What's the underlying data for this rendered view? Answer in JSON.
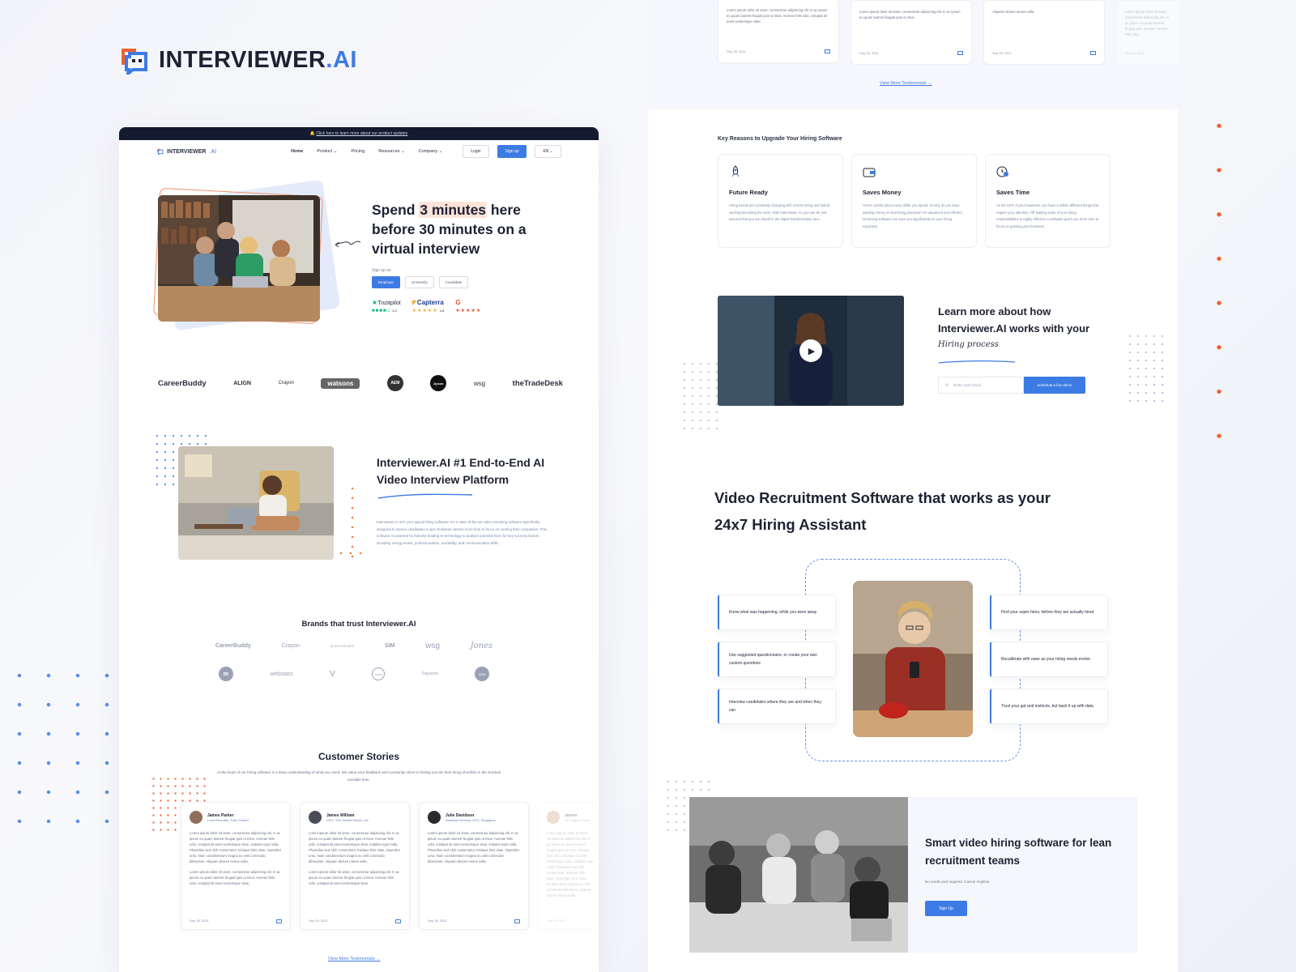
{
  "brand": {
    "name_main": "INTERVIEWER",
    "name_dot_ai": ".AI"
  },
  "left": {
    "announcement": "Click here to learn more about our product updates",
    "nav": {
      "logo_main": "INTERVIEWER",
      "logo_ai": ".AI",
      "links": [
        "Home",
        "Product ⌄",
        "Pricing",
        "Resources ⌄",
        "Company ⌄"
      ],
      "login": "Login",
      "signup": "Sign up",
      "language": "EN ⌄"
    },
    "hero": {
      "title_1": "Spend ",
      "title_hl": "3 minutes",
      "title_2": " here before 30 minutes on a virtual interview",
      "signup_as": "Sign up as",
      "roles": [
        "Employer",
        "University",
        "Candidate"
      ],
      "trustpilot": "Trustpilot",
      "trustpilot_score": "4.2",
      "capterra": "Capterra",
      "capterra_score": "4.8"
    },
    "logos": [
      "CareerBuddy",
      "ALIGN",
      "Crayon",
      "watsons",
      "AEM",
      "Dyson",
      "wsg",
      "theTradeDesk"
    ],
    "feature": {
      "title": "Interviewer.AI #1 End-to-End AI Video Interview Platform",
      "body": "Interviewer.AI isn't your typical hiring software. It's a state-of-the-art video recruiting software specifically designed to screen candidates to give business owners more time to focus on running their companies. This software is powered by industry-leading AI technology to analyze potential hires for key success factors including energy levels, professionalism, sociability, and communication skills."
    },
    "trust": {
      "title": "Brands that trust Interviewer.AI",
      "row1": [
        "CareerBuddy",
        "Crayon",
        "ALIGN PRIVATE",
        "SIM",
        "wsg",
        "Jones"
      ],
      "row2": [
        "m",
        "webstars",
        "V",
        "crest",
        "Paysend",
        "AEM"
      ]
    },
    "stories": {
      "title": "Customer Stories",
      "subtitle": "At the heart of our hiring software is a deep understanding of what you need. We value your feedback and constantly strive to finding you the best hiring shortlists in the shortest possible time.",
      "items": [
        {
          "name": "James Parker",
          "role": "Lead Recruiter, Tufa, Poland",
          "date": "Sep 28, 2021"
        },
        {
          "name": "James William",
          "role": "CEO, The Growth Works, UK",
          "date": "Sep 28, 2021"
        },
        {
          "name": "Julie Davidson",
          "role": "Assistant Director, NTU, Singapore",
          "date": "Sep 28, 2021"
        },
        {
          "name": "James",
          "role": "HR, Digital Oasis",
          "date": "Sep 28, 2021"
        }
      ],
      "lorem_1": "Lorem ipsum dolor sit amet, consectetur adipiscing elit. In ac ipsum eu quam laoreet feugiat quis ut risus. Aenean felis odio, volutpat sit amet scelerisque vitae, sodales eget nulla. Phasellus sed nibh consectetur, tristique felis vitae, imperdiet urna. Nam condimentum magna eu velit commodo bibendum. Aliquam dictum metus nulla.",
      "lorem_2": "Lorem ipsum dolor sit amet, consectetur adipiscing elit. In ac ipsum eu quam laoreet feugiat quis ut risus. Aenean felis odio, volutpat sit amet scelerisque vitae.",
      "more": "View More Testimonials →"
    }
  },
  "right": {
    "top_cards": [
      {
        "text": "Lorem ipsum dolor sit amet, consectetur adipiscing elit. In ac ipsum eu quam laoreet feugiat quis ut risus. Aenean felis odio, volutpat sit amet scelerisque vitae.",
        "date": "Sep 28, 2021"
      },
      {
        "text": "Lorem ipsum dolor sit amet, consectetur adipiscing elit. In ac ipsum eu quam laoreet feugiat quis ut risus.",
        "date": "Sep 28, 2021"
      },
      {
        "text": "Aliquam dictum metus nulla.",
        "date": "Sep 28, 2021"
      },
      {
        "text": "Lorem ipsum dolor sit amet, consectetur adipiscing elit. In ac ipsum eu quam laoreet feugiat quis ut risus. Aenean felis odio.",
        "date": "Sep 28, 2021"
      }
    ],
    "more": "View More Testimonials →",
    "key_title": "Key Reasons to Upgrade Your Hiring Software",
    "reasons": [
      {
        "title": "Future Ready",
        "desc": "Hiring trends are constantly changing with remote hiring and hybrid working becoming the norm. With Interviewer. AI, you can be rest assured that you are ahead in the digital transformation race."
      },
      {
        "title": "Saves Money",
        "desc": "You're careful about every dollar you spend, so why do you keep wasting money on bad hiring practices? An advanced and efficient screening software can save you significantly on your hiring expenses."
      },
      {
        "title": "Saves Time",
        "desc": "As the CEO of your business, you have a million different things that require your attention. Off loading some of your hiring responsibilities to highly effective AI software gives you more time to focus on growing your business."
      }
    ],
    "learn": {
      "title": "Learn more about how Interviewer.AI works with your",
      "script": "Hiring process",
      "email_placeholder": "Enter work email",
      "demo_button": "Schedule a live demo"
    },
    "assistant": {
      "title": "Video Recruitment Software that works as your 24x7 Hiring Assistant",
      "left_bullets": [
        "Know what was happening, while you were away",
        "Use suggested questionnaire, or create your own custom questions",
        "Interview candidates where they are and when they can"
      ],
      "right_bullets": [
        "Find your super hires, before they are actually hired",
        "Recalibrate with ease as your hiring needs evolve",
        "Trust your gut and instincts, but back it up with data"
      ]
    },
    "smart": {
      "title": "Smart video hiring software for lean recruitment teams",
      "subtitle": "No credit card required. Cancel Anytime",
      "button": "Sign Up"
    }
  },
  "colors": {
    "accent": "#3d7be4",
    "orange": "#f0602f",
    "dark": "#141a2f"
  }
}
